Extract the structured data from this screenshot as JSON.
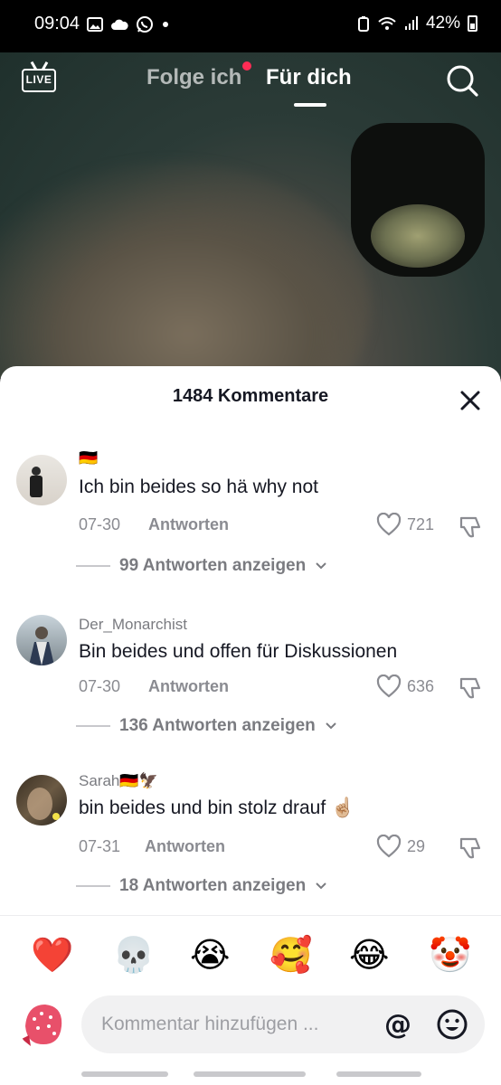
{
  "status_bar": {
    "time": "09:04",
    "battery": "42%",
    "icons": [
      "image-icon",
      "cloud-icon",
      "whatsapp-icon",
      "dot-icon",
      "battery-saver-icon",
      "wifi-icon",
      "signal-icon",
      "battery-icon"
    ]
  },
  "top_nav": {
    "live_label": "LIVE",
    "tabs": [
      {
        "label": "Folge ich",
        "active": false,
        "has_dot": true
      },
      {
        "label": "Für dich",
        "active": true
      }
    ],
    "search_icon": "search-icon"
  },
  "comments_sheet": {
    "title": "1484 Kommentare",
    "close_icon": "close-icon",
    "comments": [
      {
        "user": "🇩🇪",
        "text": "Ich bin beides so hä why not",
        "date": "07-30",
        "reply_label": "Antworten",
        "likes": "721",
        "more_replies": "99 Antworten anzeigen"
      },
      {
        "user": "Der_Monarchist",
        "text": "Bin beides und offen für Diskussionen",
        "date": "07-30",
        "reply_label": "Antworten",
        "likes": "636",
        "more_replies": "136 Antworten anzeigen"
      },
      {
        "user": "Sarah🇩🇪🦅",
        "text": "bin beides und bin stolz drauf ☝🏼",
        "date": "07-31",
        "reply_label": "Antworten",
        "likes": "29",
        "more_replies": "18 Antworten anzeigen"
      }
    ]
  },
  "quick_emojis": [
    "❤️",
    "💀",
    "😭",
    "🥰",
    "😂",
    "🤡"
  ],
  "input": {
    "placeholder": "Kommentar hinzufügen ...",
    "at_label": "@"
  },
  "colors": {
    "accent": "#fe2c55",
    "text": "#161823",
    "muted": "#8a8b91"
  }
}
